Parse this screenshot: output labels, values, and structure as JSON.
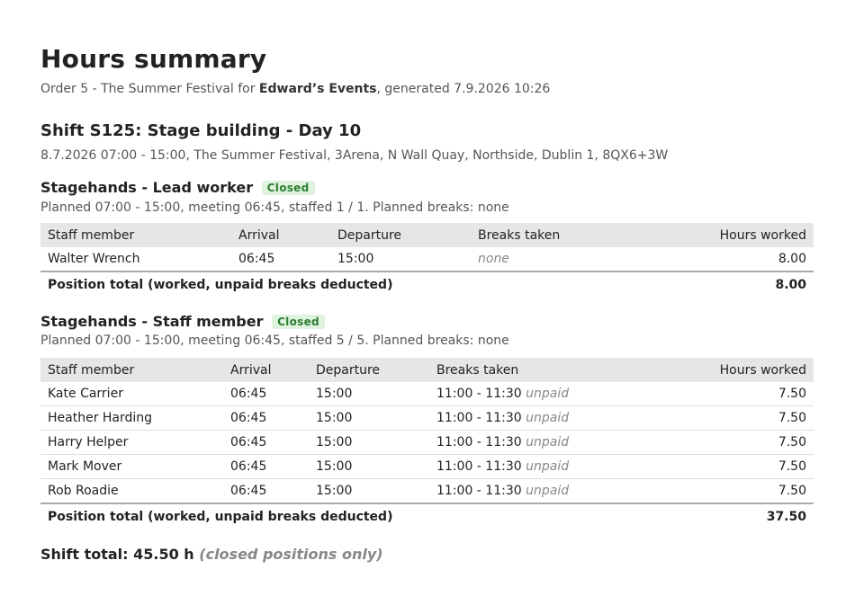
{
  "title": "Hours summary",
  "subtitle": {
    "prefix": "Order 5 - The Summer Festival for ",
    "client": "Edward’s Events",
    "suffix": ", generated 7.9.2026 10:26"
  },
  "shift": {
    "heading": "Shift S125: Stage building - Day 10",
    "meta": "8.7.2026 07:00 - 15:00, The Summer Festival, 3Arena, N Wall Quay, Northside, Dublin 1, 8QX6+3W",
    "total_label": "Shift total: 45.50 h",
    "total_note": "(closed positions only)"
  },
  "columns": [
    "Staff member",
    "Arrival",
    "Departure",
    "Breaks taken",
    "Hours worked"
  ],
  "positions": [
    {
      "title": "Stagehands - Lead worker",
      "status": "Closed",
      "meta": "Planned 07:00 - 15:00, meeting 06:45, staffed 1 / 1. Planned breaks: none",
      "rows": [
        {
          "name": "Walter Wrench",
          "arrival": "06:45",
          "departure": "15:00",
          "breaks": "none",
          "hours": "8.00"
        }
      ],
      "total_label": "Position total (worked, unpaid breaks deducted)",
      "total": "8.00"
    },
    {
      "title": "Stagehands - Staff member",
      "status": "Closed",
      "meta": "Planned 07:00 - 15:00, meeting 06:45, staffed 5 / 5. Planned breaks: none",
      "rows": [
        {
          "name": "Kate Carrier",
          "arrival": "06:45",
          "departure": "15:00",
          "breaks": "11:00 - 11:30",
          "break_type": "unpaid",
          "hours": "7.50"
        },
        {
          "name": "Heather Harding",
          "arrival": "06:45",
          "departure": "15:00",
          "breaks": "11:00 - 11:30",
          "break_type": "unpaid",
          "hours": "7.50"
        },
        {
          "name": "Harry Helper",
          "arrival": "06:45",
          "departure": "15:00",
          "breaks": "11:00 - 11:30",
          "break_type": "unpaid",
          "hours": "7.50"
        },
        {
          "name": "Mark Mover",
          "arrival": "06:45",
          "departure": "15:00",
          "breaks": "11:00 - 11:30",
          "break_type": "unpaid",
          "hours": "7.50"
        },
        {
          "name": "Rob Roadie",
          "arrival": "06:45",
          "departure": "15:00",
          "breaks": "11:00 - 11:30",
          "break_type": "unpaid",
          "hours": "7.50"
        }
      ],
      "total_label": "Position total (worked, unpaid breaks deducted)",
      "total": "37.50"
    }
  ]
}
